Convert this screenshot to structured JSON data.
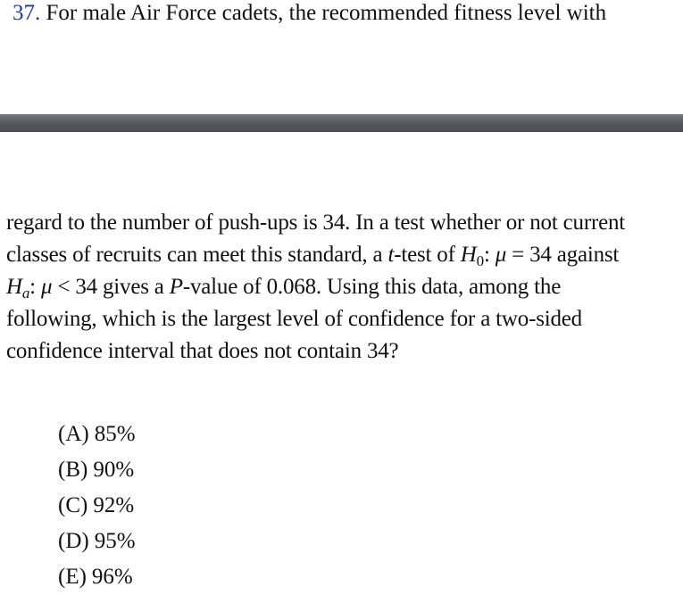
{
  "question": {
    "number": "37.",
    "header_text": " For male Air Force cadets, the recommended fitness level with",
    "line1": "regard to the number of push-ups is 34. In a test whether or not current",
    "line2_a": "classes of recruits can meet this standard, a ",
    "line2_t": "t",
    "line2_b": "-test of ",
    "line2_H": "H",
    "line2_sub": "0",
    "line2_colon": ": ",
    "line2_mu": "μ",
    "line2_c": " = 34 against",
    "line3_H": "H",
    "line3_sub": "a",
    "line3_colon": ": ",
    "line3_mu": "μ",
    "line3_b": " < 34 gives a ",
    "line3_P": "P",
    "line3_c": "-value of 0.068. Using this data, among the",
    "line4": "following, which is the largest level of confidence for a two-sided",
    "line5": "confidence interval that does not contain 34?"
  },
  "choices": [
    {
      "letter": "(A)",
      "value": "85%"
    },
    {
      "letter": "(B)",
      "value": "90%"
    },
    {
      "letter": "(C)",
      "value": "92%"
    },
    {
      "letter": "(D)",
      "value": "95%"
    },
    {
      "letter": "(E)",
      "value": "96%"
    }
  ],
  "colors": {
    "question_number": "#1f3a93",
    "divider_bar": "#55595d"
  }
}
